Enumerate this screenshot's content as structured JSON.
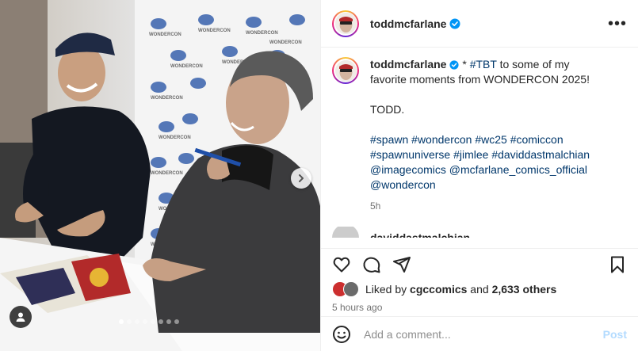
{
  "post": {
    "username": "toddmcfarlane",
    "more_label": "•••",
    "caption": {
      "username": "toddmcfarlane",
      "line1_prefix": "* ",
      "line1_tag": "#TBT",
      "line1_rest": " to some of my favorite moments from WONDERCON 2025!",
      "signature": "TODD.",
      "hashtags": [
        "#spawn",
        "#wondercon",
        "#wc25",
        "#comiccon",
        "#spawnuniverse",
        "#jimlee",
        "#daviddastmalchian"
      ],
      "mentions": [
        "@imagecomics",
        "@mcfarlane_comics_official",
        "@wondercon"
      ],
      "time": "5h"
    },
    "next_comment_partial": "daviddastmalchian",
    "likes": {
      "prefix": "Liked by ",
      "user": "cgccomics",
      "middle": " and ",
      "count": "2,633 others"
    },
    "time_ago": "5 hours ago",
    "comment": {
      "placeholder": "Add a comment...",
      "post_label": "Post"
    }
  },
  "carousel": {
    "total": 8,
    "active": 0
  },
  "colors": {
    "link": "#00376b",
    "verified": "#0095f6",
    "muted": "#737373",
    "post_disabled": "#b3dbff"
  },
  "icons": [
    "chevron-right-icon",
    "user-tag-icon",
    "more-icon",
    "verified-icon",
    "heart-icon",
    "comment-icon",
    "share-icon",
    "bookmark-icon",
    "emoji-icon"
  ]
}
